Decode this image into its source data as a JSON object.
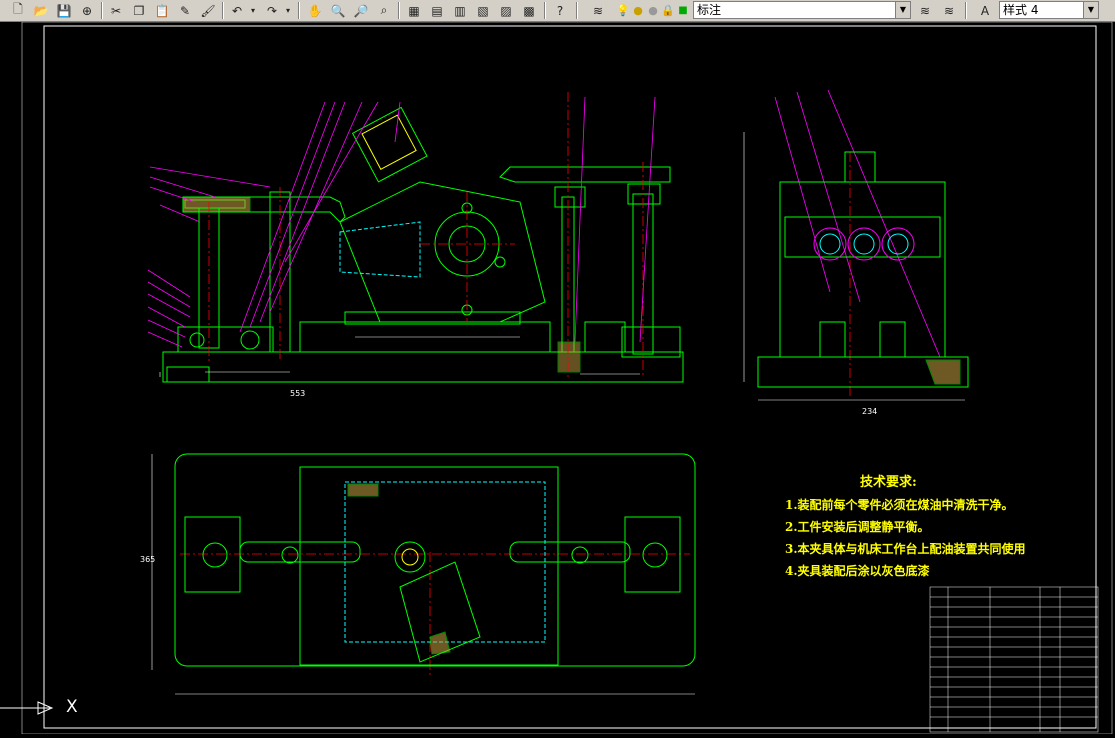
{
  "toolbar": {
    "buttons": [
      "new-icon",
      "open-icon",
      "save-icon",
      "plot-icon",
      "cut-icon",
      "copy-icon",
      "paste-icon",
      "match-properties-icon",
      "brush-icon",
      "undo-icon",
      "redo-icon",
      "pan-icon",
      "zoom-realtime-icon",
      "zoom-window-icon",
      "zoom-previous-icon",
      "properties-icon",
      "design-center-icon",
      "tool-palettes-icon",
      "sheet-set-icon",
      "markup-icon",
      "calculator-icon",
      "help-icon"
    ],
    "layer_combo": {
      "value": "标注"
    },
    "style_combo": {
      "value": "样式 4"
    }
  },
  "drawing": {
    "tech_requirements": {
      "title": "技术要求:",
      "items": [
        "1.装配前每个零件必须在煤油中清洗干净。",
        "2.工件安装后调整静平衡。",
        "3.本夹具体与机床工作台上配油装置共同使用",
        "4.夹具装配后涂以灰色底漆"
      ]
    },
    "dimensions": {
      "bottom_width": "553",
      "side_width": "234",
      "left_height": "365"
    },
    "colors": {
      "outline": "#00ff00",
      "leader": "#ff00ff",
      "text": "#ffff00",
      "centerline": "#ff0000",
      "hidden": "#00ffff",
      "frame": "#ffffff"
    }
  },
  "ucs_icon": {
    "axis_label": "X"
  }
}
